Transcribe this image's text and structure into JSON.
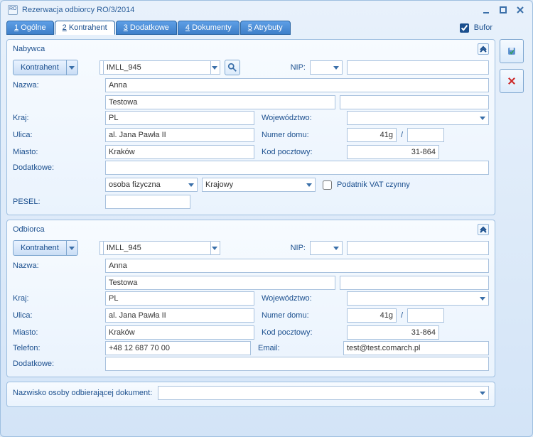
{
  "window": {
    "title": "Rezerwacja odbiorcy RO/3/2014"
  },
  "tabs": [
    {
      "u": "1",
      "label": "Ogólne"
    },
    {
      "u": "2",
      "label": "Kontrahent"
    },
    {
      "u": "3",
      "label": "Dodatkowe"
    },
    {
      "u": "4",
      "label": "Dokumenty"
    },
    {
      "u": "5",
      "label": "Atrybuty"
    }
  ],
  "bufor": {
    "label": "Bufor"
  },
  "nabywca": {
    "title": "Nabywca",
    "kontrahent_btn": "Kontrahent",
    "kontrahent_value": "IMLL_945",
    "nip_label": "NIP:",
    "nip_prefix": "",
    "nip_value": "",
    "nazwa_label": "Nazwa:",
    "nazwa1": "Anna",
    "nazwa2": "Testowa",
    "nazwa3": "",
    "kraj_label": "Kraj:",
    "kraj": "PL",
    "woj_label": "Województwo:",
    "woj": "",
    "ulica_label": "Ulica:",
    "ulica": "al. Jana Pawła II",
    "nrd_label": "Numer domu:",
    "nrd": "41g",
    "nrd2": "",
    "miasto_label": "Miasto:",
    "miasto": "Kraków",
    "kod_label": "Kod pocztowy:",
    "kod": "31-864",
    "dod_label": "Dodatkowe:",
    "dod": "",
    "typ1": "osoba fizyczna",
    "typ2": "Krajowy",
    "vat_label": "Podatnik VAT czynny",
    "pesel_label": "PESEL:",
    "pesel": ""
  },
  "odbiorca": {
    "title": "Odbiorca",
    "kontrahent_btn": "Kontrahent",
    "kontrahent_value": "IMLL_945",
    "nip_label": "NIP:",
    "nip_prefix": "",
    "nip_value": "",
    "nazwa_label": "Nazwa:",
    "nazwa1": "Anna",
    "nazwa2": "Testowa",
    "nazwa3": "",
    "kraj_label": "Kraj:",
    "kraj": "PL",
    "woj_label": "Województwo:",
    "woj": "",
    "ulica_label": "Ulica:",
    "ulica": "al. Jana Pawła II",
    "nrd_label": "Numer domu:",
    "nrd": "41g",
    "nrd2": "",
    "miasto_label": "Miasto:",
    "miasto": "Kraków",
    "kod_label": "Kod pocztowy:",
    "kod": "31-864",
    "tel_label": "Telefon:",
    "tel": "+48 12 687 70 00",
    "email_label": "Email:",
    "email": "test@test.comarch.pl",
    "dod_label": "Dodatkowe:",
    "dod": ""
  },
  "footer": {
    "label": "Nazwisko osoby odbierającej dokument:",
    "value": ""
  }
}
